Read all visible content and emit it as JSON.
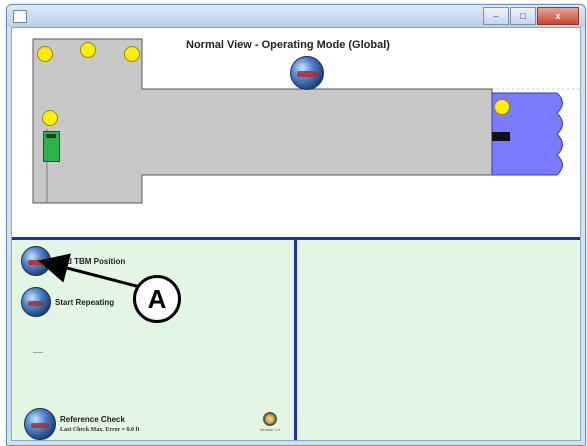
{
  "window": {
    "title": "",
    "controls": {
      "minimize": "–",
      "maximize": "□",
      "close": "x"
    }
  },
  "top_view": {
    "title": "Normal View - Operating Mode (Global)",
    "globe_icon": "globe-icon",
    "colors": {
      "machine": "#c8c8c8",
      "cutter": "#7a7aff",
      "sensor": "#ffee00",
      "module": "#2eb24a"
    }
  },
  "panel": {
    "find_tbm": {
      "label": "Find TBM Position",
      "icon": "globe-icon"
    },
    "start_repeating": {
      "label": "Start Repeating",
      "icon": "globe-icon"
    },
    "reference_check": {
      "label": "Reference Check",
      "subtext": "Last Check Max. Error = 0.0 ft",
      "icon": "globe-icon"
    },
    "version_text": "Version 2.0",
    "colors": {
      "background": "#e3f5e3",
      "divider": "#1f2fb0"
    }
  },
  "callout": {
    "letter": "A"
  }
}
